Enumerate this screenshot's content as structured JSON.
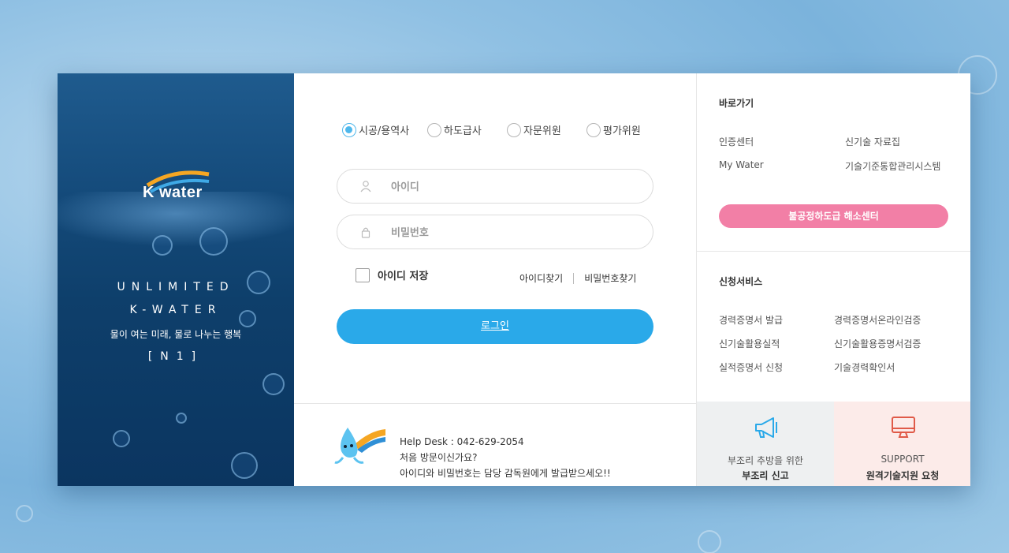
{
  "brand": {
    "logo_text": "K water",
    "slogan_line1": "UNLIMITED",
    "slogan_line2": "K-WATER",
    "slogan_line3": "물이 여는 미래, 물로 나누는 행복",
    "slogan_line4": "[N1]"
  },
  "login": {
    "roles": [
      {
        "label": "시공/용역사",
        "checked": true
      },
      {
        "label": "하도급사",
        "checked": false
      },
      {
        "label": "자문위원",
        "checked": false
      },
      {
        "label": "평가위원",
        "checked": false
      }
    ],
    "id_placeholder": "아이디",
    "pw_placeholder": "비밀번호",
    "save_id_label": "아이디 저장",
    "find_id_label": "아이디찾기",
    "find_pw_label": "비밀번호찾기",
    "login_button": "로그인"
  },
  "helpdesk": {
    "line1": "Help Desk : 042-629-2054",
    "line2": "처음 방문이신가요?",
    "line3": "아이디와 비밀번호는 담당 감독원에게 발급받으세오!!"
  },
  "shortcuts": {
    "title": "바로가기",
    "links": [
      "인증센터",
      "신기술 자료집",
      "My Water",
      "기술기준통합관리시스템"
    ],
    "pink_button": "불공정하도급 해소센터"
  },
  "services": {
    "title": "신청서비스",
    "links": [
      "경력증명서 발급",
      "경력증명서온라인검증",
      "신기술활용실적",
      "신기술활용증명서검증",
      "실적증명서 신청",
      "기술경력확인서"
    ]
  },
  "tiles": {
    "report_line1": "부조리 추방을 위한",
    "report_line2": "부조리 신고",
    "support_line1": "SUPPORT",
    "support_line2": "원격기술지원 요청"
  },
  "colors": {
    "brand_navy": "#144a7a",
    "accent_blue": "#2aa9e9",
    "radio_blue": "#4fb8ec",
    "pink": "#f27fa6",
    "report_icon": "#2aa9e9",
    "support_icon": "#e05a48"
  },
  "icons": {
    "id_field": "user-icon",
    "pw_field": "lock-icon",
    "report_tile": "megaphone-icon",
    "support_tile": "monitor-icon"
  }
}
